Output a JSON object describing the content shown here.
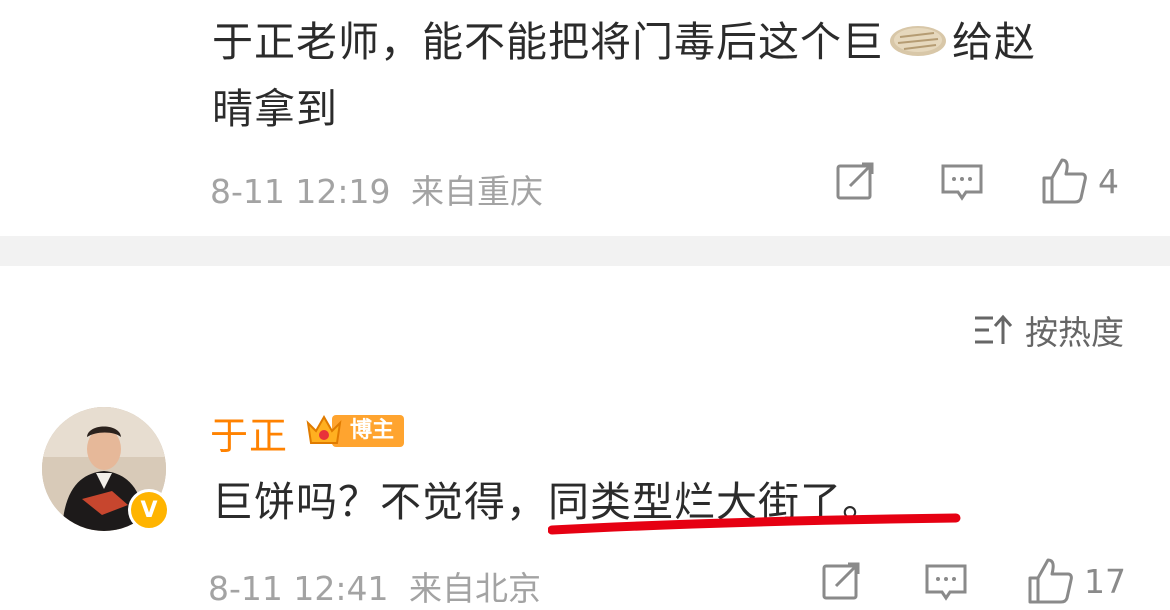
{
  "comment1": {
    "text_line1_a": "于正老师，能不能把将门毒后这个巨",
    "emoji": "pie-emoji",
    "text_line1_b": "给赵",
    "text_line2": "晴拿到",
    "date": "8-11 12:19",
    "location": "来自重庆",
    "like_count": "4"
  },
  "sort": {
    "label": "按热度"
  },
  "comment2": {
    "username": "于正",
    "badge": "博主",
    "text_plain": "巨饼吗？不觉得，",
    "text_underlined": "同类型烂大街了。",
    "date": "8-11 12:41",
    "location": "来自北京",
    "like_count": "17",
    "verified_label": "V"
  },
  "colors": {
    "accent": "#ff8200",
    "underline": "#e60012",
    "meta": "#a3a3a3"
  }
}
